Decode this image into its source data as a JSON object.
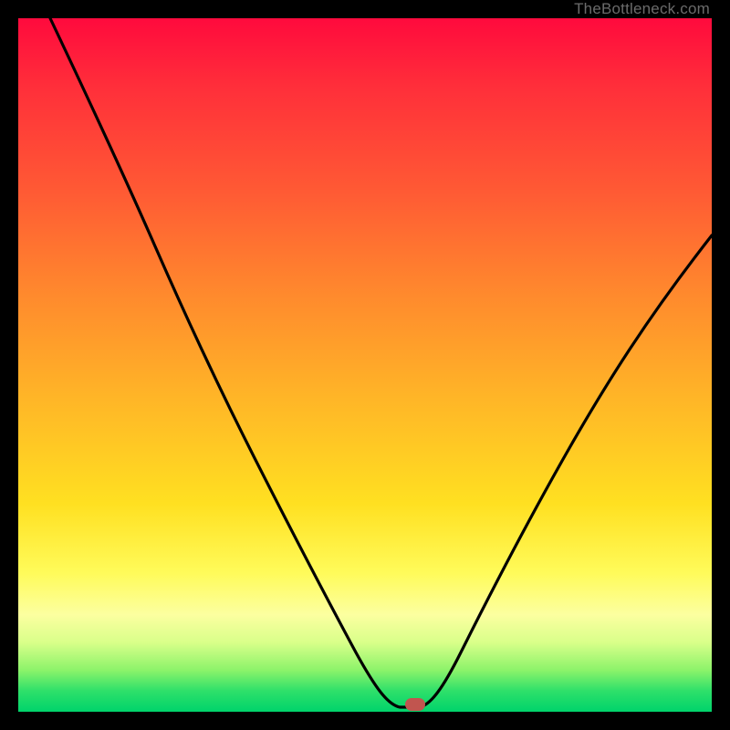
{
  "watermark": "TheBottleneck.com",
  "chart_data": {
    "type": "line",
    "title": "",
    "xlabel": "",
    "ylabel": "",
    "xlim": [
      0,
      100
    ],
    "ylim": [
      0,
      100
    ],
    "series": [
      {
        "name": "bottleneck-curve",
        "x": [
          5,
          10,
          15,
          20,
          25,
          30,
          35,
          40,
          45,
          50,
          52,
          54,
          56,
          58,
          60,
          65,
          70,
          75,
          80,
          85,
          90,
          95,
          100
        ],
        "values": [
          100,
          90,
          80,
          70,
          60,
          50,
          40,
          30,
          20,
          10,
          5,
          2,
          0,
          0,
          2,
          10,
          20,
          30,
          40,
          48,
          55,
          60,
          64
        ]
      }
    ],
    "annotations": [
      {
        "name": "minimum-marker",
        "x": 57,
        "y": 0
      }
    ],
    "background_gradient": {
      "top": "#ff0a3d",
      "mid_upper": "#ff8a2d",
      "mid": "#ffe021",
      "mid_lower": "#fcffa0",
      "bottom": "#00d36b"
    }
  }
}
